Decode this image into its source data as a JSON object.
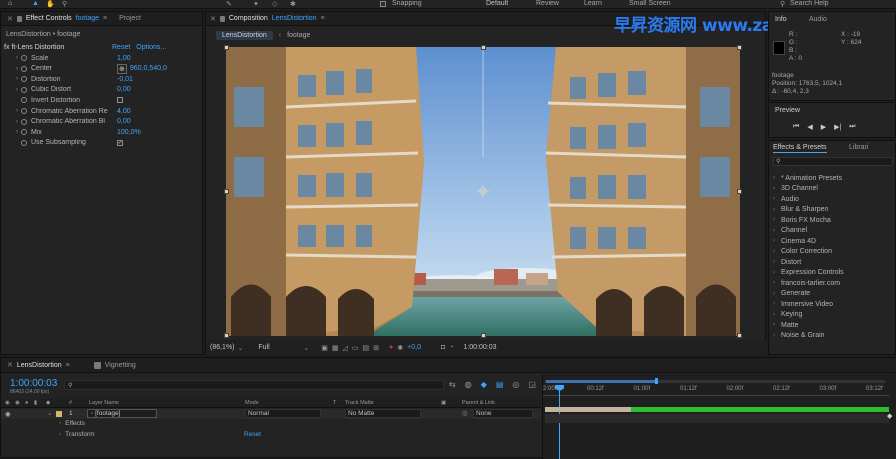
{
  "top": {
    "snapping": "Snapping",
    "workspaces": [
      "Default",
      "Review",
      "Learn",
      "Small Screen"
    ],
    "search_help": "Search Help"
  },
  "watermark": "早昇资源网 www.zaosang.com",
  "effect_controls": {
    "tab_label": "Effect Controls",
    "tab_target": "footage",
    "project_tab": "Project",
    "breadcrumb": "LensDistortion • footage",
    "effect_name": "fx  ft-Lens Distortion",
    "reset": "Reset",
    "options": "Options...",
    "props": [
      {
        "name": "Scale",
        "value": "1,00",
        "kind": "num"
      },
      {
        "name": "Center",
        "value": "960,0,540,0",
        "kind": "point"
      },
      {
        "name": "Distortion",
        "value": "-0,01",
        "kind": "num"
      },
      {
        "name": "Cubic Distort",
        "value": "0,00",
        "kind": "num"
      },
      {
        "name": "Invert Distortion",
        "value": "",
        "kind": "check"
      },
      {
        "name": "Chromatic Aberration Re",
        "value": "4,00",
        "kind": "num"
      },
      {
        "name": "Chromatic Aberration Bl",
        "value": "0,00",
        "kind": "num"
      },
      {
        "name": "Mix",
        "value": "100,0%",
        "kind": "num"
      },
      {
        "name": "Use Subsampling",
        "value": "",
        "kind": "checked"
      }
    ]
  },
  "composition": {
    "tab_label": "Composition",
    "tab_target": "LensDistortion",
    "crumb_active": "LensDistortion",
    "crumb_next": "footage",
    "zoom": "(86,1%)",
    "resolution": "Full",
    "exposure": "+0,0",
    "timecode": "1:00:00:03"
  },
  "info": {
    "tab": "Info",
    "audio_tab": "Audio",
    "r": "R :",
    "g": "G :",
    "b": "B :",
    "a": "A :  0",
    "x": "X : -19",
    "y": "Y : 624",
    "source": "footage",
    "position": "Position: 1763,5, 1024,1",
    "delta": "Δ : -60,4, 2,3"
  },
  "preview": {
    "title": "Preview"
  },
  "effects_presets": {
    "tab": "Effects & Presets",
    "library_tab": "Librari",
    "search_placeholder": "",
    "items": [
      "* Animation Presets",
      "3D Channel",
      "Audio",
      "Blur & Sharpen",
      "Boris FX Mocha",
      "Channel",
      "Cinema 4D",
      "Color Correction",
      "Distort",
      "Expression Controls",
      "francois-tarlier.com",
      "Generate",
      "Immersive Video",
      "Keying",
      "Matte",
      "Noise & Grain"
    ]
  },
  "timeline": {
    "tabs": [
      "LensDistortion",
      "Vignetting"
    ],
    "timecode": "1:00:00:03",
    "sub": "86403 (24.00 fps)",
    "headers": {
      "num": "#",
      "layer_name": "Layer Name",
      "mode": "Mode",
      "t": "T",
      "track_matte": "Track Matte",
      "parent": "Parent & Link"
    },
    "layer": {
      "num": "1",
      "name": "[footage]",
      "mode": "Normal",
      "matte": "No Matte",
      "parent": "None"
    },
    "effects": "Effects",
    "transform": "Transform",
    "transform_reset": "Reset",
    "ruler": [
      "2:00f",
      "00:12f",
      "01:00f",
      "01:12f",
      "02:00f",
      "02:12f",
      "03:00f",
      "03:12f"
    ]
  },
  "colors": {
    "accent": "#3fa5ff",
    "bar_green": "#2dbd2d",
    "layer_chip": "#d7b56d"
  }
}
